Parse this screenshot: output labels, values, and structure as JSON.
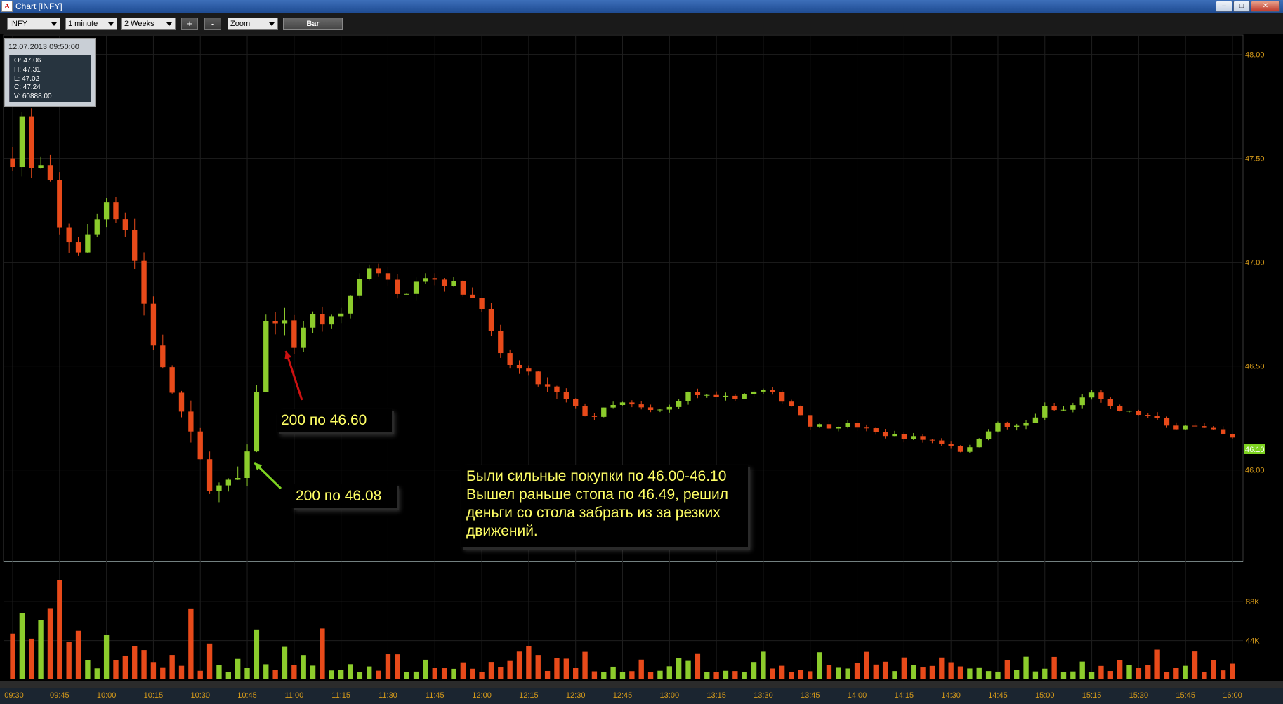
{
  "window": {
    "title": "Chart [INFY]",
    "app_glyph": "A",
    "buttons": [
      "minimize-icon",
      "maximize-icon",
      "close-icon"
    ],
    "button_glyphs": [
      "–",
      "□",
      "✕"
    ]
  },
  "toolbar": {
    "symbol": "INFY",
    "interval": "1 minute",
    "period": "2 Weeks",
    "plus": "+",
    "minus": "-",
    "zoom": "Zoom",
    "bar": "Bar"
  },
  "ohlc": {
    "timestamp": "12.07.2013 09:50:00",
    "open": "O: 47.06",
    "high": "H: 47.31",
    "low": "L: 47.02",
    "close": "C: 47.24",
    "volume": "V: 60888.00"
  },
  "annotations": {
    "sell": "200 по 46.60",
    "buy": "200 по 46.08",
    "comment_lines": [
      "Были сильные покупки по 46.00-46.10",
      "Вышел раньше стопа по 46.49, решил",
      "деньги со стола забрать из за резких",
      "движений."
    ]
  },
  "colors": {
    "up": "#8ccc2c",
    "down": "#e84a1a",
    "axis_text": "#d59a1a",
    "grid": "#1e1e1e",
    "last_price_bg": "#7ed321",
    "note_text": "#ffff66",
    "arrow_sell": "#cc1111",
    "arrow_buy": "#7ed321"
  },
  "chart_data": {
    "type": "candlestick",
    "symbol": "INFY",
    "date": "12.07.2013",
    "xlim": [
      "09:30",
      "16:00"
    ],
    "ylim": [
      45.6,
      48.1
    ],
    "price_ticks": [
      48.0,
      47.5,
      47.0,
      46.5,
      46.0
    ],
    "price_tick_labels": [
      "48.00",
      "47.50",
      "47.00",
      "46.50",
      "46.00"
    ],
    "last_price": "46.10",
    "time_labels": [
      "09:30",
      "09:45",
      "10:00",
      "10:15",
      "10:30",
      "10:45",
      "11:00",
      "11:15",
      "11:30",
      "11:45",
      "12:00",
      "12:15",
      "12:30",
      "12:45",
      "13:00",
      "13:15",
      "13:30",
      "13:45",
      "14:00",
      "14:15",
      "14:30",
      "14:45",
      "15:00",
      "15:15",
      "15:30",
      "15:45",
      "16:00"
    ],
    "price_path": [
      [
        "09:30",
        47.5
      ],
      [
        "09:33",
        47.7
      ],
      [
        "09:37",
        47.35
      ],
      [
        "09:40",
        47.5
      ],
      [
        "09:45",
        47.15
      ],
      [
        "09:52",
        47.05
      ],
      [
        "10:00",
        47.3
      ],
      [
        "10:07",
        47.15
      ],
      [
        "10:12",
        46.8
      ],
      [
        "10:17",
        46.5
      ],
      [
        "10:22",
        46.35
      ],
      [
        "10:27",
        46.15
      ],
      [
        "10:32",
        45.95
      ],
      [
        "10:37",
        45.9
      ],
      [
        "10:42",
        45.95
      ],
      [
        "10:45",
        46.05
      ],
      [
        "10:47",
        46.3
      ],
      [
        "10:51",
        46.7
      ],
      [
        "10:55",
        46.75
      ],
      [
        "11:00",
        46.6
      ],
      [
        "11:05",
        46.75
      ],
      [
        "11:10",
        46.7
      ],
      [
        "11:15",
        46.75
      ],
      [
        "11:20",
        46.9
      ],
      [
        "11:25",
        47.0
      ],
      [
        "11:30",
        46.9
      ],
      [
        "11:35",
        46.85
      ],
      [
        "11:40",
        46.95
      ],
      [
        "11:45",
        46.92
      ],
      [
        "11:50",
        46.9
      ],
      [
        "11:55",
        46.85
      ],
      [
        "12:00",
        46.8
      ],
      [
        "12:05",
        46.55
      ],
      [
        "12:10",
        46.5
      ],
      [
        "12:15",
        46.45
      ],
      [
        "12:20",
        46.4
      ],
      [
        "12:25",
        46.35
      ],
      [
        "12:30",
        46.3
      ],
      [
        "12:35",
        46.25
      ],
      [
        "12:40",
        46.3
      ],
      [
        "12:45",
        46.32
      ],
      [
        "12:50",
        46.3
      ],
      [
        "12:55",
        46.28
      ],
      [
        "13:00",
        46.3
      ],
      [
        "13:05",
        46.37
      ],
      [
        "13:10",
        46.36
      ],
      [
        "13:15",
        46.34
      ],
      [
        "13:20",
        46.35
      ],
      [
        "13:25",
        46.37
      ],
      [
        "13:30",
        46.38
      ],
      [
        "13:35",
        46.35
      ],
      [
        "13:40",
        46.3
      ],
      [
        "13:45",
        46.22
      ],
      [
        "13:50",
        46.21
      ],
      [
        "13:55",
        46.22
      ],
      [
        "14:00",
        46.21
      ],
      [
        "14:05",
        46.18
      ],
      [
        "14:10",
        46.17
      ],
      [
        "14:15",
        46.16
      ],
      [
        "14:20",
        46.15
      ],
      [
        "14:25",
        46.14
      ],
      [
        "14:30",
        46.12
      ],
      [
        "14:35",
        46.08
      ],
      [
        "14:40",
        46.18
      ],
      [
        "14:45",
        46.22
      ],
      [
        "14:50",
        46.2
      ],
      [
        "14:55",
        46.23
      ],
      [
        "15:00",
        46.3
      ],
      [
        "15:05",
        46.28
      ],
      [
        "15:10",
        46.32
      ],
      [
        "15:15",
        46.38
      ],
      [
        "15:20",
        46.3
      ],
      [
        "15:25",
        46.28
      ],
      [
        "15:30",
        46.27
      ],
      [
        "15:35",
        46.25
      ],
      [
        "15:40",
        46.2
      ],
      [
        "15:45",
        46.22
      ],
      [
        "15:50",
        46.2
      ],
      [
        "15:55",
        46.18
      ],
      [
        "16:00",
        46.15
      ]
    ],
    "volume_ticks": [
      "88K",
      "44K"
    ],
    "volume_tick_values": [
      88000,
      44000
    ],
    "volume_ylim": [
      0,
      135000
    ]
  }
}
